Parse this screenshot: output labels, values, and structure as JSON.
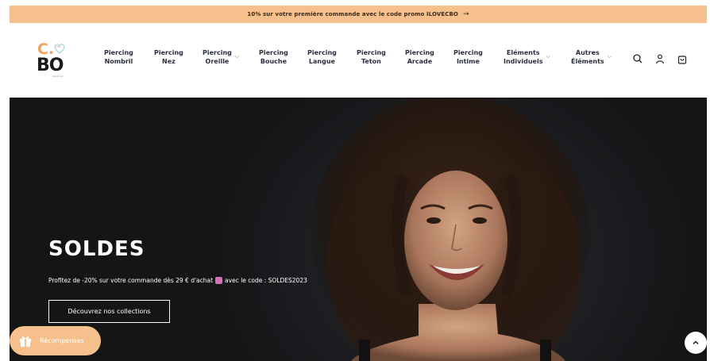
{
  "announcement": {
    "text": "10% sur votre première commande avec le code promo ILOVECBO",
    "arrow": "→"
  },
  "logo": {
    "line1": "C.",
    "line2": "BO",
    "tagline": "piercings"
  },
  "nav": [
    {
      "label": "Piercing\nNombril",
      "dropdown": false
    },
    {
      "label": "Piercing\nNez",
      "dropdown": false
    },
    {
      "label": "Piercing\nOreille",
      "dropdown": true
    },
    {
      "label": "Piercing\nBouche",
      "dropdown": false
    },
    {
      "label": "Piercing\nLangue",
      "dropdown": false
    },
    {
      "label": "Piercing\nTeton",
      "dropdown": false
    },
    {
      "label": "Piercing\nArcade",
      "dropdown": false
    },
    {
      "label": "Piercing\nIntime",
      "dropdown": false
    },
    {
      "label": "Eléments\nIndividuels",
      "dropdown": true
    },
    {
      "label": "Autres\nÉléments",
      "dropdown": true
    }
  ],
  "header_icons": [
    "search-icon",
    "account-icon",
    "cart-icon"
  ],
  "hero": {
    "title": "SOLDES",
    "subtitle_before": "Profitez de -20% sur votre commande dès 29 € d'achat",
    "subtitle_after": "avec le code : SOLDES2023",
    "button": "Découvrez nos collections"
  },
  "rewards": {
    "label": "Récompenses"
  },
  "colors": {
    "accent": "#f6c08d",
    "nav_text": "#2b3040",
    "hero_bg": "#1d1f22"
  }
}
